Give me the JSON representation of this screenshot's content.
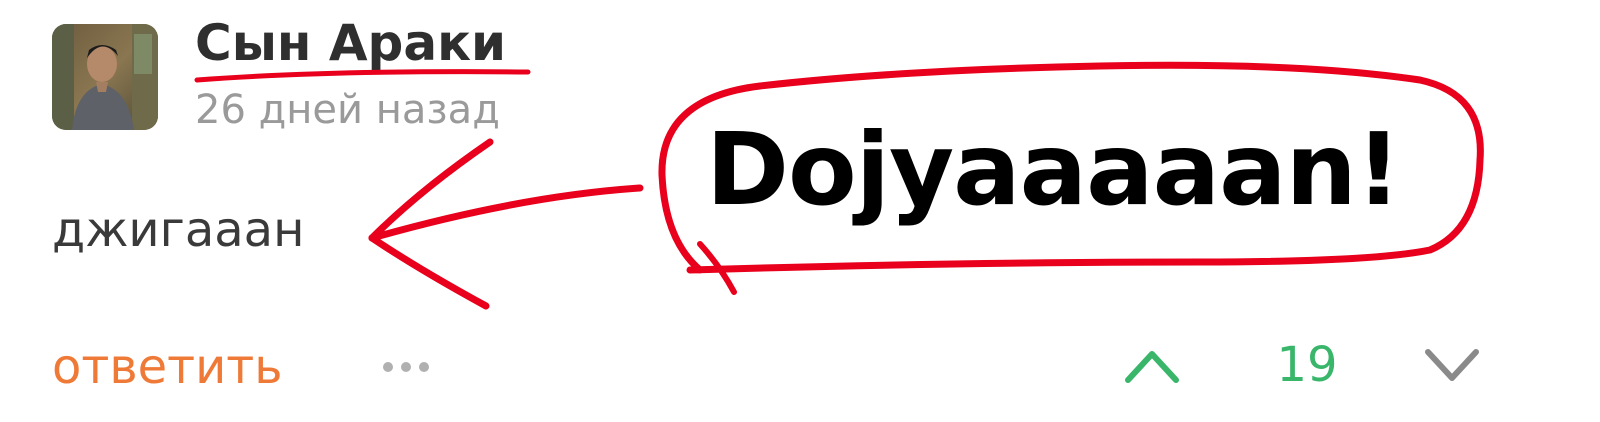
{
  "comment": {
    "author": "Сын Араки",
    "timestamp": "26 дней назад",
    "text": "джигааан"
  },
  "actions": {
    "reply_label": "ответить",
    "more_icon": "ellipsis-icon",
    "upvote_icon": "chevron-up-icon",
    "score": "19",
    "downvote_icon": "chevron-down-icon"
  },
  "annotation": {
    "caption": "Dojyaaaaan!"
  },
  "colors": {
    "author": "#2f2f2f",
    "timestamp": "#9a9a9a",
    "reply": "#ef7a38",
    "score": "#39b66a",
    "icon_gray": "#b0b0b0",
    "annotation_red": "#e8001c"
  }
}
